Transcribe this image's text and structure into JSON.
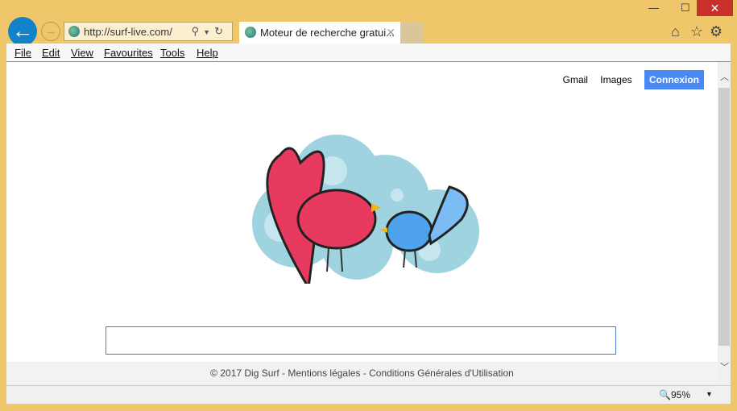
{
  "browser": {
    "address": "http://surf-live.com/",
    "tab_title": "Moteur de recherche gratui...",
    "tab_close": "✕",
    "menu": [
      "File",
      "Edit",
      "View",
      "Favourites",
      "Tools",
      "Help"
    ],
    "minimize": "—",
    "maximize": "☐",
    "close": "✕",
    "home_icon": "⌂",
    "star_icon": "☆",
    "gear_icon": "⚙",
    "zoom": "95%"
  },
  "page": {
    "links": {
      "gmail": "Gmail",
      "images": "Images",
      "connexion": "Connexion"
    },
    "search_value": "",
    "footer": "© 2017 Dig Surf - Mentions légales - Conditions Générales d'Utilisation"
  },
  "colors": {
    "accent": "#4a89f3",
    "frame": "#efc76a"
  }
}
